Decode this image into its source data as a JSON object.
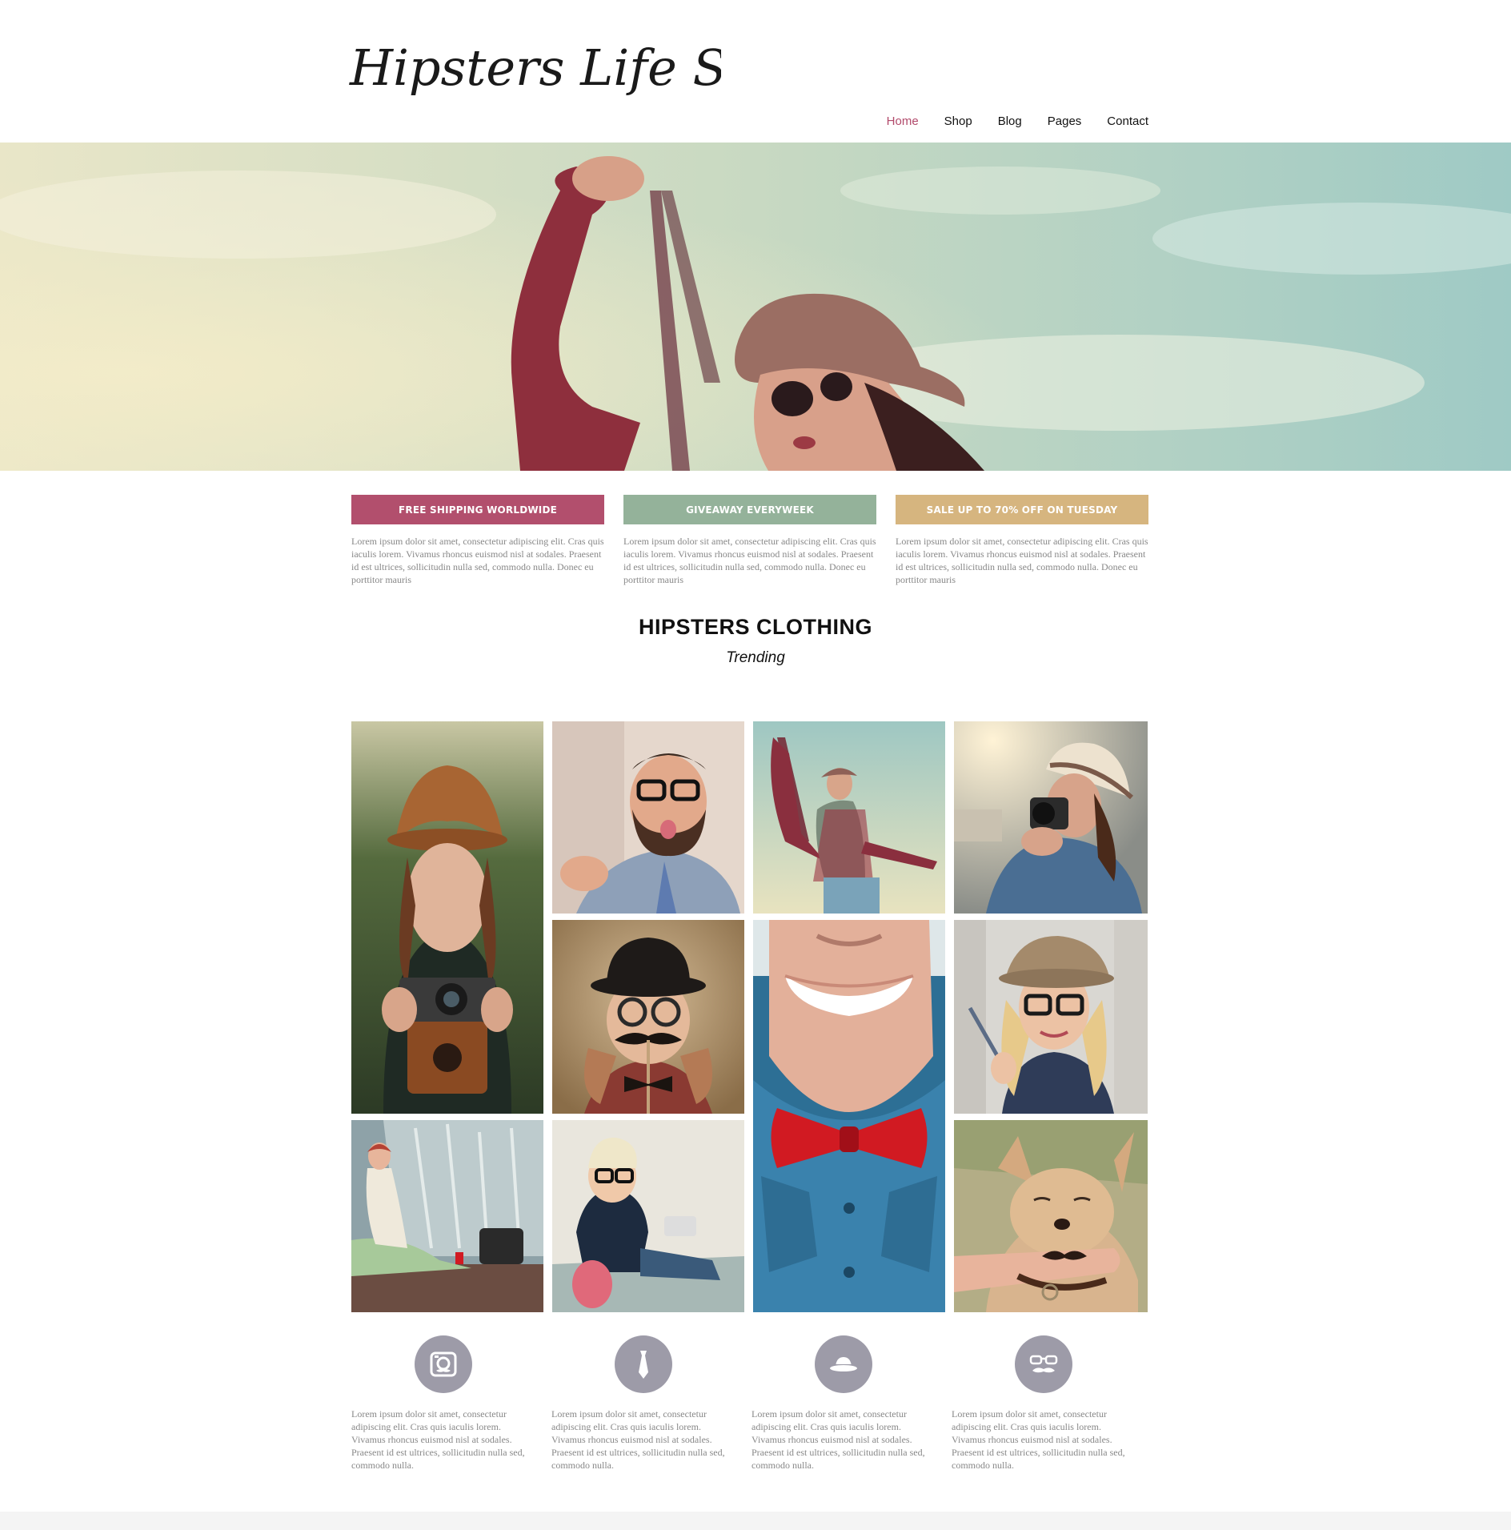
{
  "header": {
    "logo_text": "Hipsters Life Style",
    "nav": [
      {
        "label": "Home",
        "active": true
      },
      {
        "label": "Shop",
        "active": false
      },
      {
        "label": "Blog",
        "active": false
      },
      {
        "label": "Pages",
        "active": false
      },
      {
        "label": "Contact",
        "active": false
      }
    ]
  },
  "features": [
    {
      "label": "FREE SHIPPING WORLDWIDE",
      "color": "#b24f6d",
      "text": "Lorem ipsum dolor sit amet, consectetur adipiscing elit. Cras quis iaculis lorem. Vivamus rhoncus euismod nisl at sodales. Praesent id est ultrices, sollicitudin nulla sed, commodo nulla. Donec eu porttitor mauris"
    },
    {
      "label": "GIVEAWAY EVERYWEEK",
      "color": "#94b29a",
      "text": "Lorem ipsum dolor sit amet, consectetur adipiscing elit. Cras quis iaculis lorem. Vivamus rhoncus euismod nisl at sodales. Praesent id est ultrices, sollicitudin nulla sed, commodo nulla. Donec eu porttitor mauris"
    },
    {
      "label": "SALE UP TO 70% OFF ON TUESDAY",
      "color": "#d6b57f",
      "text": "Lorem ipsum dolor sit amet, consectetur adipiscing elit. Cras quis iaculis lorem. Vivamus rhoncus euismod nisl at sodales. Praesent id est ultrices, sollicitudin nulla sed, commodo nulla. Donec eu porttitor mauris"
    }
  ],
  "section": {
    "title": "HIPSTERS CLOTHING",
    "subtitle": "Trending"
  },
  "gallery": [
    {
      "name": "photo-woman-hat-camera"
    },
    {
      "name": "photo-bearded-man-glasses"
    },
    {
      "name": "photo-woman-sky-camera-strap"
    },
    {
      "name": "photo-woman-white-hat-camera"
    },
    {
      "name": "photo-child-bowler-hat-mustache"
    },
    {
      "name": "photo-man-red-bowtie"
    },
    {
      "name": "photo-woman-glasses-pencil"
    },
    {
      "name": "photo-woman-sitting-fountain"
    },
    {
      "name": "photo-toddler-headphones"
    },
    {
      "name": "photo-dog-finger-mustache"
    }
  ],
  "icon_features": [
    {
      "icon": "camera-icon",
      "text": "Lorem ipsum dolor sit amet, consectetur adipiscing elit. Cras quis iaculis lorem. Vivamus rhoncus euismod nisl at sodales. Praesent id est ultrices, sollicitudin nulla sed, commodo nulla."
    },
    {
      "icon": "tie-icon",
      "text": "Lorem ipsum dolor sit amet, consectetur adipiscing elit. Cras quis iaculis lorem. Vivamus rhoncus euismod nisl at sodales. Praesent id est ultrices, sollicitudin nulla sed, commodo nulla."
    },
    {
      "icon": "hat-icon",
      "text": "Lorem ipsum dolor sit amet, consectetur adipiscing elit. Cras quis iaculis lorem. Vivamus rhoncus euismod nisl at sodales. Praesent id est ultrices, sollicitudin nulla sed, commodo nulla."
    },
    {
      "icon": "glasses-mustache-icon",
      "text": "Lorem ipsum dolor sit amet, consectetur adipiscing elit. Cras quis iaculis lorem. Vivamus rhoncus euismod nisl at sodales. Praesent id est ultrices, sollicitudin nulla sed, commodo nulla."
    }
  ],
  "colors": {
    "accent": "#b24a6b",
    "icon_bg": "#9d9ba8",
    "body_text": "#888888"
  }
}
